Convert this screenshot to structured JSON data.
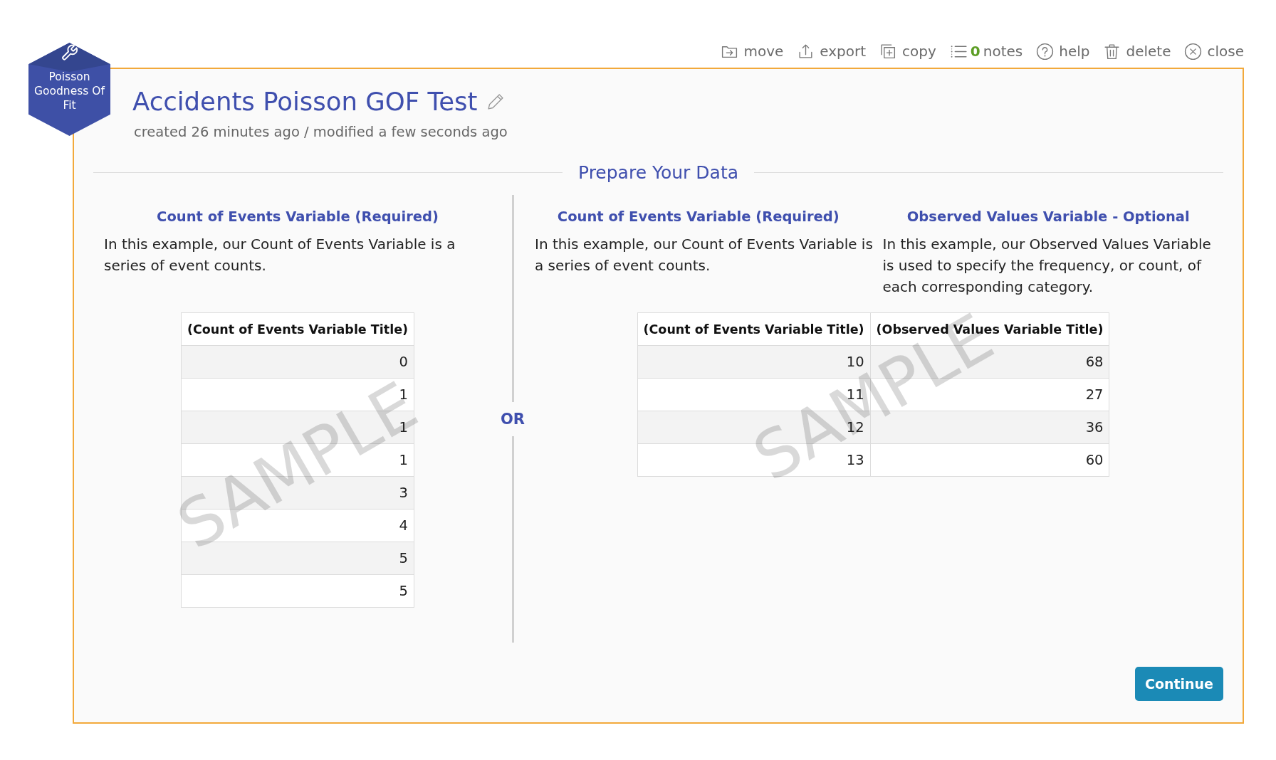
{
  "toolbar": [
    {
      "kind": "move",
      "label": "move"
    },
    {
      "kind": "export",
      "label": "export"
    },
    {
      "kind": "copy",
      "label": "copy"
    },
    {
      "kind": "notes",
      "count": "0",
      "label": "notes"
    },
    {
      "kind": "help",
      "label": "help"
    },
    {
      "kind": "delete",
      "label": "delete"
    },
    {
      "kind": "close",
      "label": "close"
    }
  ],
  "badge": {
    "label": "Poisson Goodness Of Fit"
  },
  "document": {
    "title": "Accidents Poisson GOF Test",
    "meta": "created 26 minutes ago / modified a few seconds ago"
  },
  "section": {
    "title": "Prepare Your Data"
  },
  "options": [
    {
      "variables": [
        {
          "heading": "Count of Events Variable (Required)",
          "description": "In this example, our Count of Events Variable is a series of event counts."
        }
      ],
      "table": {
        "columns": [
          "(Count of Events Variable Title)"
        ],
        "rows": [
          [
            "0"
          ],
          [
            "1"
          ],
          [
            "1"
          ],
          [
            "1"
          ],
          [
            "3"
          ],
          [
            "4"
          ],
          [
            "5"
          ],
          [
            "5"
          ]
        ]
      },
      "overlay": "SAMPLE"
    },
    {
      "variables": [
        {
          "heading": "Count of Events Variable (Required)",
          "description": "In this example, our Count of Events Variable is a series of event counts."
        },
        {
          "heading": "Observed Values Variable - Optional",
          "description": "In this example, our Observed Values Variable is used to specify the frequency, or count, of each corresponding category."
        }
      ],
      "table": {
        "columns": [
          "(Count of Events Variable Title)",
          "(Observed Values Variable Title)"
        ],
        "rows": [
          [
            "10",
            "68"
          ],
          [
            "11",
            "27"
          ],
          [
            "12",
            "36"
          ],
          [
            "13",
            "60"
          ]
        ]
      },
      "overlay": "SAMPLE"
    }
  ],
  "separator": "OR",
  "continue_button": "Continue"
}
